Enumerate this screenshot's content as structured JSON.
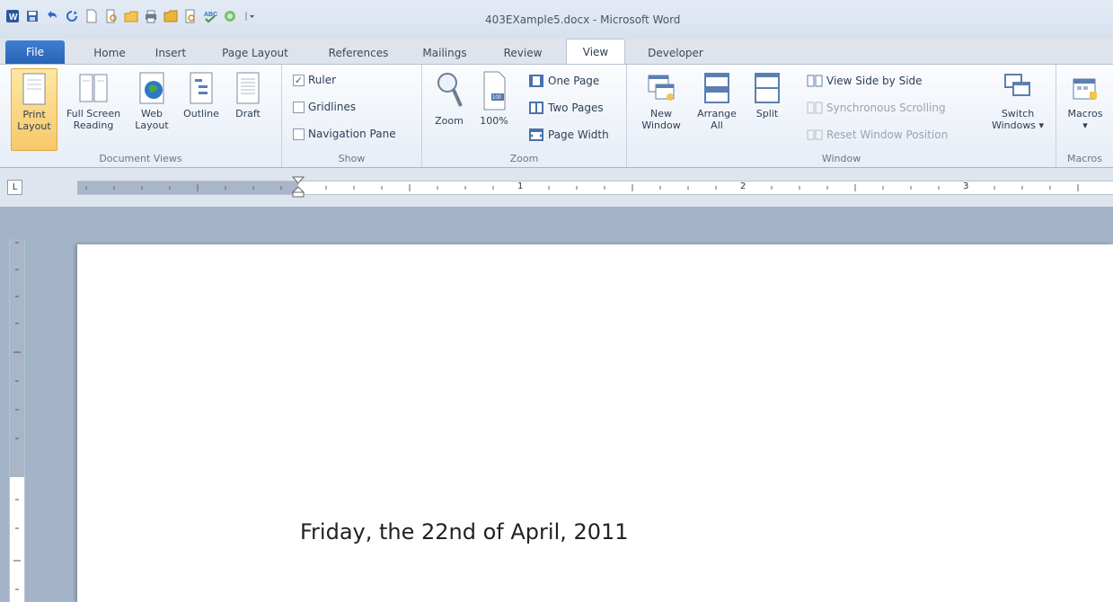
{
  "window": {
    "title": "403EXample5.docx - Microsoft Word"
  },
  "quick_access": [
    "word-icon",
    "save-icon",
    "undo-icon",
    "redo-icon",
    "new-icon",
    "print-preview-icon",
    "open-icon",
    "quick-print-icon",
    "folder-icon",
    "preview-icon",
    "spelling-icon",
    "refresh-icon",
    "customize-icon"
  ],
  "tabs": {
    "file": "File",
    "home": "Home",
    "insert": "Insert",
    "page_layout": "Page Layout",
    "references": "References",
    "mailings": "Mailings",
    "review": "Review",
    "view": "View",
    "developer": "Developer"
  },
  "ribbon": {
    "document_views": {
      "label": "Document Views",
      "print_layout": [
        "Print",
        "Layout"
      ],
      "full_screen": [
        "Full Screen",
        "Reading"
      ],
      "web_layout": [
        "Web",
        "Layout"
      ],
      "outline": "Outline",
      "draft": "Draft"
    },
    "show": {
      "label": "Show",
      "ruler": "Ruler",
      "ruler_checked": true,
      "gridlines": "Gridlines",
      "navigation_pane": "Navigation Pane"
    },
    "zoom": {
      "label": "Zoom",
      "zoom": "Zoom",
      "percent": "100%",
      "one_page": "One Page",
      "two_pages": "Two Pages",
      "page_width": "Page Width"
    },
    "window": {
      "label": "Window",
      "new_window": [
        "New",
        "Window"
      ],
      "arrange_all": [
        "Arrange",
        "All"
      ],
      "split": "Split",
      "side_by_side": "View Side by Side",
      "sync_scrolling": "Synchronous Scrolling",
      "reset_position": "Reset Window Position",
      "switch_windows": [
        "Switch",
        "Windows ▾"
      ]
    },
    "macros": {
      "label": "Macros",
      "macros": "Macros"
    }
  },
  "ruler": {
    "tab_selector": "L",
    "numbers": [
      "1",
      "2",
      "3"
    ]
  },
  "document": {
    "text": "Friday, the 22nd of April, 2011"
  },
  "colors": {
    "file_tab": "#2a62b4",
    "selected_button": "#f7c86a",
    "workspace": "#a4b4c8"
  }
}
